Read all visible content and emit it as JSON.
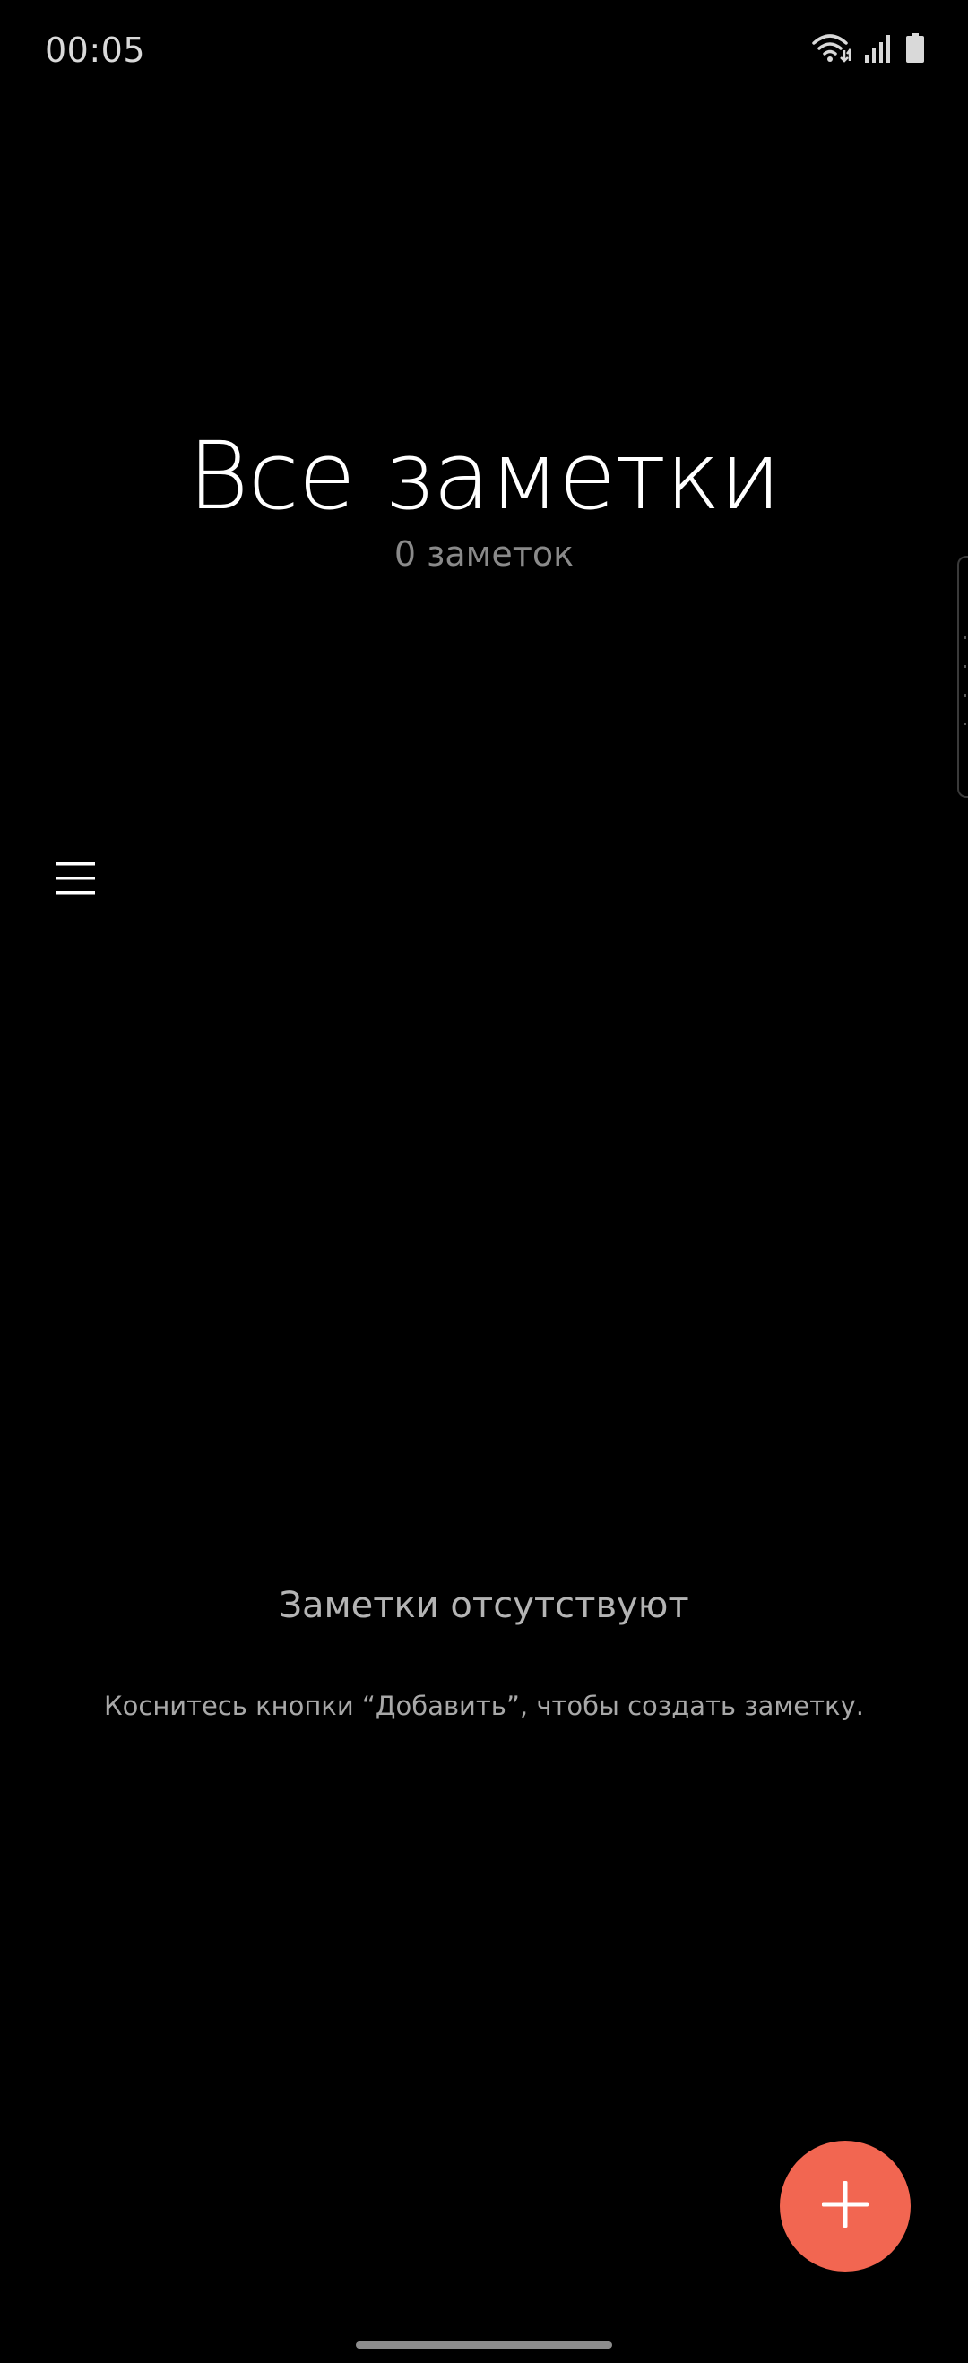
{
  "status_bar": {
    "time": "00:05",
    "icons": [
      "wifi-icon",
      "signal-icon",
      "battery-icon"
    ]
  },
  "header": {
    "title": "Все заметки",
    "count_text": "0 заметок"
  },
  "menu": {
    "icon": "hamburger-menu-icon"
  },
  "empty_state": {
    "title": "Заметки отсутствуют",
    "hint": "Коснитесь кнопки “Добавить”, чтобы создать заметку."
  },
  "fab": {
    "icon": "plus-icon",
    "color": "#f26651"
  },
  "colors": {
    "background": "#000000",
    "accent": "#f26651"
  }
}
